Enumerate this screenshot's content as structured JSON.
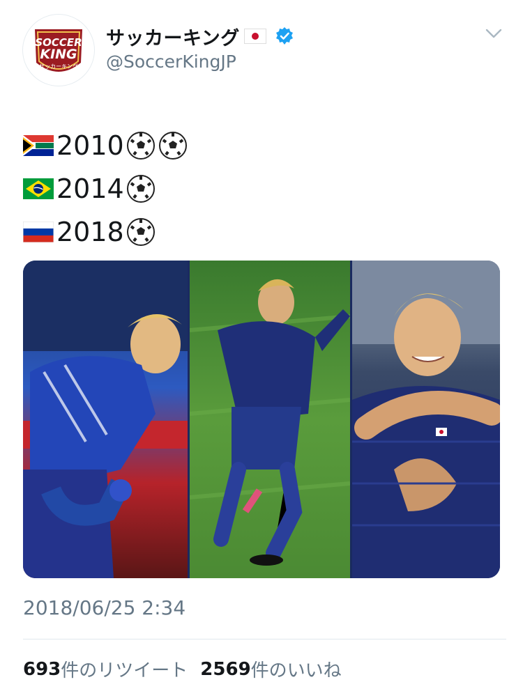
{
  "tweet": {
    "display_name": "サッカーキング",
    "handle": "@SoccerKingJP",
    "avatar_logo_text": "SOCCER KING サッカーキング",
    "lines": [
      {
        "flag": "south-africa-flag",
        "year": "2010",
        "balls": 2
      },
      {
        "flag": "brazil-flag",
        "year": "2014",
        "balls": 1
      },
      {
        "flag": "russia-flag",
        "year": "2018",
        "balls": 1
      }
    ],
    "timestamp": "2018/06/25 2:34",
    "retweets": {
      "count": "693",
      "label": "件のリツイート"
    },
    "likes": {
      "count": "2569",
      "label": "件のいいね"
    }
  },
  "colors": {
    "brand_red": "#9b1b22",
    "verified_blue": "#1da1f2",
    "secondary_text": "#657786"
  }
}
